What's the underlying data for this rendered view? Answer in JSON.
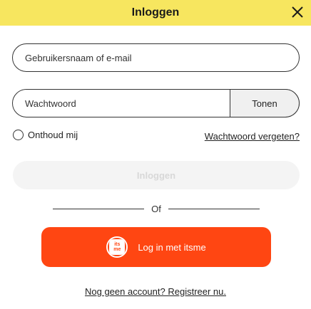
{
  "header": {
    "title": "Inloggen",
    "close_icon": "close-icon",
    "background_color": "#f7e65f"
  },
  "form": {
    "username_placeholder": "Gebruikersnaam of e-mail",
    "password_placeholder": "Wachtwoord",
    "show_label": "Tonen",
    "remember_label": "Onthoud mij",
    "forgot_label": "Wachtwoord vergeten?",
    "login_label": "Inloggen"
  },
  "divider": {
    "text": "Of"
  },
  "itsme": {
    "label": "Log in met itsme",
    "logo_top": "its",
    "logo_bottom": "me",
    "color": "#ff4612"
  },
  "register": {
    "label": "Nog geen account? Registreer nu."
  }
}
